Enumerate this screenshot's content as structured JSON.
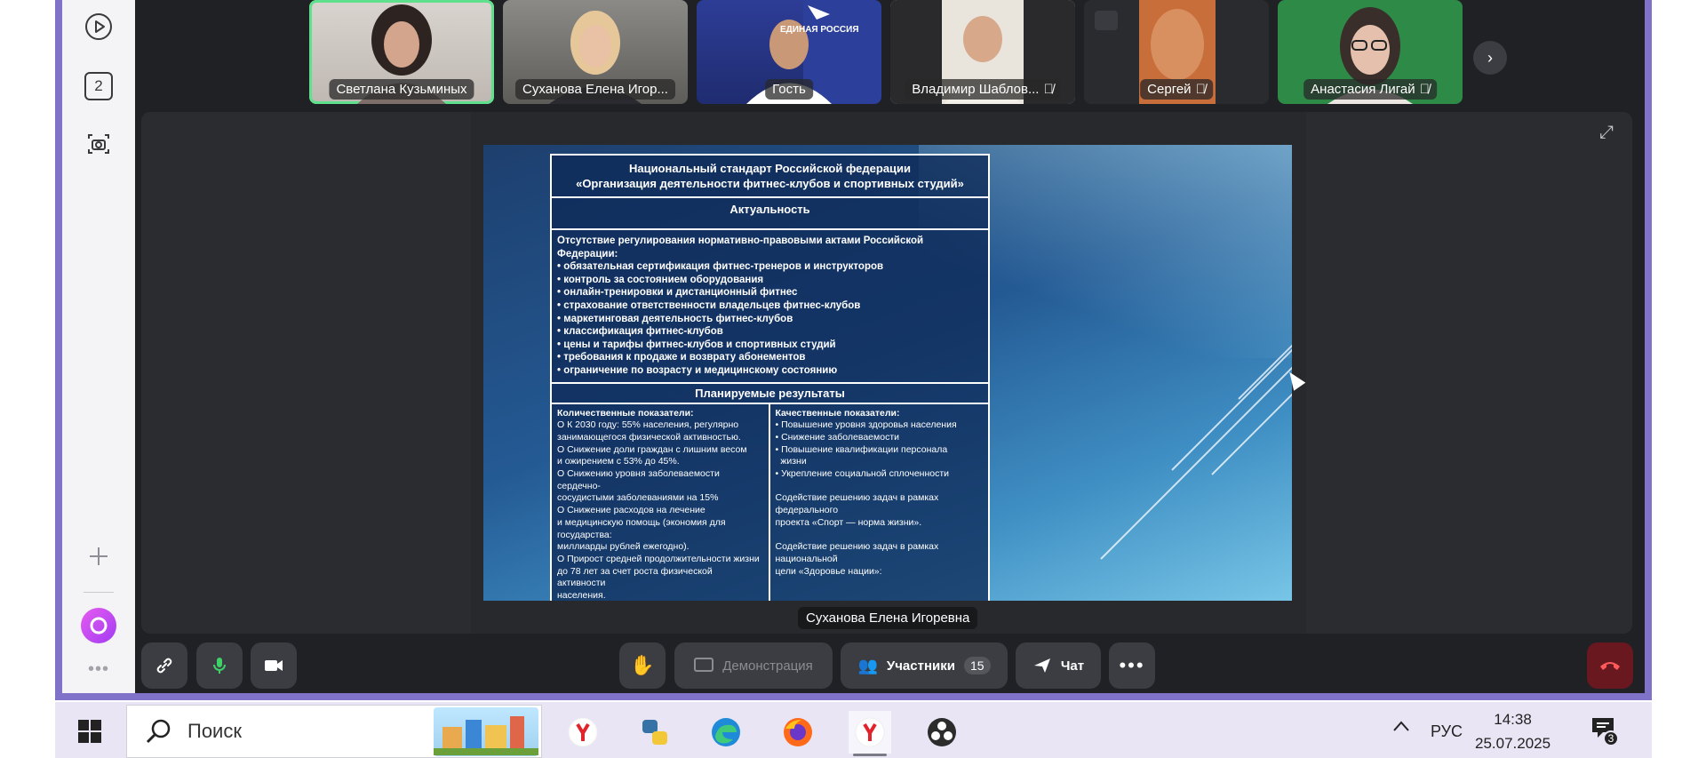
{
  "colors": {
    "accent_purple": "#8172c9",
    "app_dark": "#202124",
    "active_speaker_border": "#5fe08c",
    "hangup_red": "#6a1820"
  },
  "sidebar": {
    "items": [
      {
        "icon": "play-circle-icon"
      },
      {
        "icon": "counter-icon",
        "text": "2"
      },
      {
        "icon": "camera-screenshot-icon"
      },
      {
        "icon": "plus-icon"
      },
      {
        "icon": "alice-assistant-icon"
      },
      {
        "icon": "more-dots-icon"
      }
    ]
  },
  "participants": [
    {
      "name": "Светлана Кузьминых",
      "muted": false,
      "active": true
    },
    {
      "name": "Суханова Елена Игор...",
      "muted": false,
      "active": false
    },
    {
      "name": "Гость",
      "muted": false,
      "active": false
    },
    {
      "name": "Владимир Шаблов...",
      "muted": true,
      "active": false
    },
    {
      "name": "Сергей",
      "muted": true,
      "active": false
    },
    {
      "name": "Анастасия Лигай",
      "muted": true,
      "active": false
    }
  ],
  "tile_texts": {
    "banner": "ЕДИНАЯ РОССИЯ"
  },
  "slide": {
    "header_line1": "Национальный стандарт Российской федерации",
    "header_line2": "«Организация деятельности фитнес-клубов и спортивных студий»",
    "section_relevance": "Актуальность",
    "list_intro": "Отсутствие регулирования нормативно-правовыми актами Российской Федерации:",
    "list_items": [
      "• обязательная сертификация фитнес-тренеров и инструкторов",
      "• контроль за состоянием оборудования",
      "• онлайн-тренировки и дистанционный фитнес",
      "• страхование ответственности владельцев фитнес-клубов",
      "• маркетинговая деятельность фитнес-клубов",
      "• классификация фитнес-клубов",
      "• цены и тарифы фитнес-клубов и спортивных студий",
      "• требования к продаже и возврату абонементов",
      "• ограничение по возрасту и медицинскому состоянию"
    ],
    "section_results": "Планируемые результаты",
    "quantitative_title": "Количественные показатели:",
    "quantitative_lines": [
      "О К 2030 году: 55% населения, регулярно",
      "занимающегося физической активностью.",
      "О Снижение доли граждан с лишним весом",
      "и ожирением с 53% до 45%.",
      "О Снижению уровня заболеваемости сердечно-",
      "сосудистыми заболеваниями на 15%",
      "О Снижение расходов на лечение",
      "и медицинскую помощь (экономия для государства:",
      "миллиарды рублей ежегодно).",
      "О Прирост средней продолжительности жизни",
      "до 78 лет за счет роста физической активности",
      "населения."
    ],
    "qualitative_title": "Качественные показатели:",
    "qualitative_lines": [
      "• Повышение уровня здоровья населения",
      "• Снижение заболеваемости",
      "• Повышение квалификации персонала",
      "  жизни",
      "• Укрепление социальной сплоченности",
      "",
      "Содействие решению задач в рамках федерального",
      "проекта «Спорт — норма жизни».",
      "",
      "Содействие решению задач в рамках национальной",
      "цели «Здоровье нации»:"
    ]
  },
  "presenter_label": "Суханова Елена Игоревна",
  "toolbar": {
    "link_icon": "link-icon",
    "mic_icon": "microphone-icon",
    "camera_icon": "camera-icon",
    "raise_hand_icon": "raise-hand-icon",
    "demo_label": "Демонстрация",
    "participants_label": "Участники",
    "participants_count": "15",
    "chat_label": "Чат",
    "more_icon": "more-horizontal-icon",
    "hangup_icon": "hangup-icon"
  },
  "taskbar": {
    "search_placeholder": "Поиск",
    "apps": [
      "yandex-browser-icon",
      "python-icon",
      "edge-icon",
      "firefox-icon",
      "yandex-browser-icon",
      "obs-icon"
    ],
    "lang": "РУС",
    "time": "14:38",
    "date": "25.07.2025",
    "notifications": "3"
  }
}
